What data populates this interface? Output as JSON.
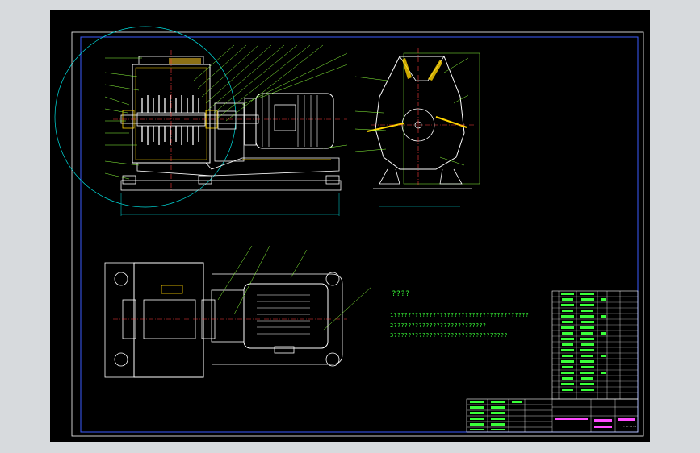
{
  "notes": {
    "title": "????",
    "lines": [
      "1??????????????????????????????????????",
      "2??????????????????????????",
      "3????????????????????????????????"
    ]
  },
  "title_block": {
    "code": "········"
  },
  "colors": {
    "background": "#000000",
    "outer": "#d7dadd",
    "border": "#3c5cff",
    "geometry": "#ffffff",
    "leaders": "#8cff3c",
    "text": "#39ff39",
    "centerline": "#ff3c3c",
    "dimension": "#00e0e0",
    "hatch": "#ffd400",
    "magenta": "#ff4cff"
  }
}
